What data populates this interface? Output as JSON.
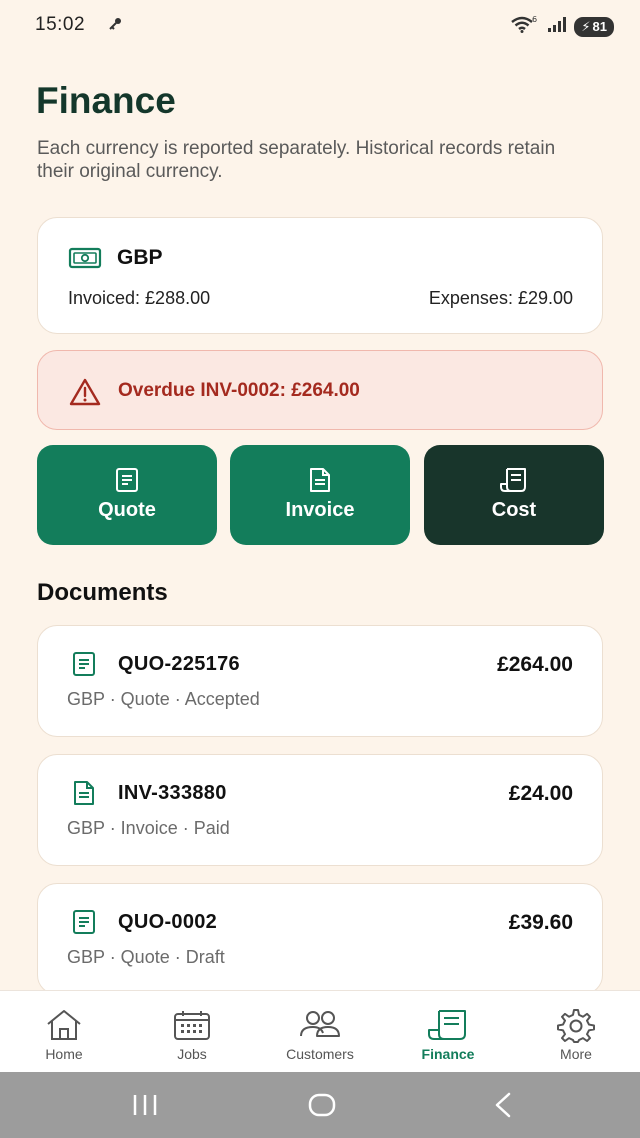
{
  "status_bar": {
    "time": "15:02",
    "battery": "81",
    "wifi_badge": "6"
  },
  "header": {
    "title": "Finance",
    "subtitle": "Each currency is reported separately. Historical records retain their original currency."
  },
  "currency_card": {
    "icon": "banknote-icon",
    "code": "GBP",
    "invoiced": "Invoiced: £288.00",
    "expenses": "Expenses: £29.00"
  },
  "alert": {
    "icon": "warning-icon",
    "text": "Overdue INV-0002: £264.00",
    "color": "#a42a1f"
  },
  "actions": [
    {
      "label": "Quote",
      "icon": "quote-document-icon"
    },
    {
      "label": "Invoice",
      "icon": "invoice-document-icon"
    },
    {
      "label": "Cost",
      "icon": "receipt-icon"
    }
  ],
  "documents": {
    "title": "Documents",
    "items": [
      {
        "number": "QUO-225176",
        "amount": "£264.00",
        "meta": "GBP · Quote · Accepted",
        "icon": "quote-document-icon"
      },
      {
        "number": "INV-333880",
        "amount": "£24.00",
        "meta": "GBP · Invoice · Paid",
        "icon": "invoice-document-icon"
      },
      {
        "number": "QUO-0002",
        "amount": "£39.60",
        "meta": "GBP · Quote · Draft",
        "icon": "quote-document-icon"
      }
    ]
  },
  "bottom_nav": {
    "items": [
      {
        "label": "Home",
        "icon": "home-icon"
      },
      {
        "label": "Jobs",
        "icon": "calendar-icon"
      },
      {
        "label": "Customers",
        "icon": "users-icon"
      },
      {
        "label": "Finance",
        "icon": "receipt-icon",
        "active": true
      },
      {
        "label": "More",
        "icon": "gear-icon"
      }
    ]
  },
  "colors": {
    "accent": "#137d5b",
    "dark": "#18352b",
    "background": "#fdf4ea",
    "alert": "#a42a1f"
  }
}
